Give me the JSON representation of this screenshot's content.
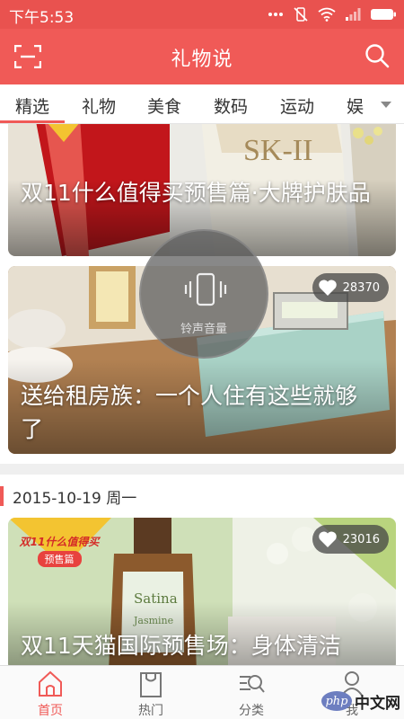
{
  "status_bar": {
    "time": "下午5:53",
    "icons": [
      "more-dots-icon",
      "mute-icon",
      "wifi-icon",
      "signal-icon",
      "battery-icon"
    ]
  },
  "header": {
    "title": "礼物说",
    "left_icon": "scan-icon",
    "right_icon": "search-icon",
    "color": "#f05a57"
  },
  "tabs": {
    "items": [
      {
        "label": "精选",
        "active": true
      },
      {
        "label": "礼物",
        "active": false
      },
      {
        "label": "美食",
        "active": false
      },
      {
        "label": "数码",
        "active": false
      },
      {
        "label": "运动",
        "active": false
      },
      {
        "label": "娱",
        "active": false
      }
    ],
    "more_icon": "dropdown-arrow-icon"
  },
  "feed": {
    "cards": [
      {
        "title": "双11什么值得买预售篇·大牌护肤品"
      },
      {
        "title": "送给租房族：一个人住有这些就够了",
        "likes": "28370"
      }
    ],
    "date_header": "2015-10-19 周一",
    "cards_after_date": [
      {
        "title": "双11天猫国际预售场：身体清洁",
        "likes": "23016",
        "badge_line1": "双11什么值得买",
        "badge_line2": "预售篇"
      }
    ]
  },
  "volume_overlay": {
    "label": "铃声音量",
    "icon": "phone-vibrate-icon"
  },
  "bottom_nav": {
    "items": [
      {
        "label": "首页",
        "icon": "home-icon",
        "active": true
      },
      {
        "label": "热门",
        "icon": "shopping-bag-icon",
        "active": false
      },
      {
        "label": "分类",
        "icon": "category-search-icon",
        "active": false
      },
      {
        "label": "我",
        "icon": "user-icon",
        "active": false
      }
    ]
  },
  "watermark": {
    "logo_text": "php",
    "site_text": "中文网"
  }
}
